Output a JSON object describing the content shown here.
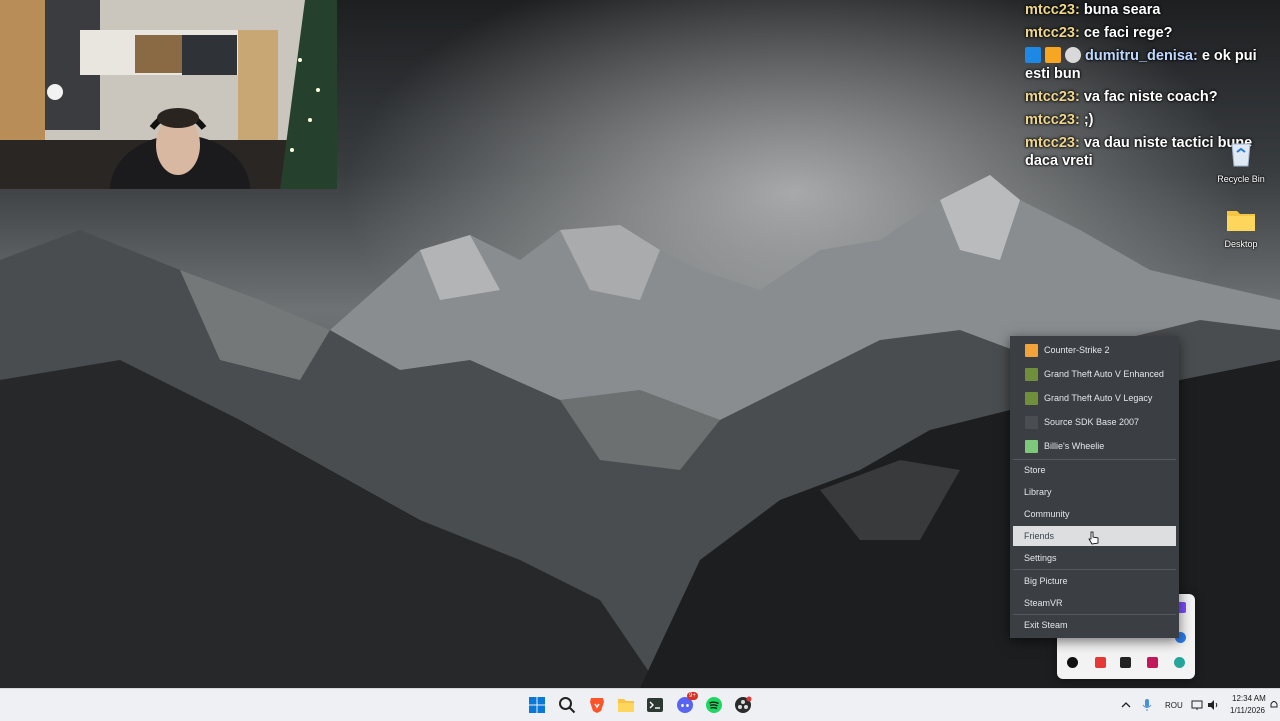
{
  "chat": [
    {
      "user": "mtcc23:",
      "text": "buna seara",
      "color": "gold"
    },
    {
      "user": "mtcc23:",
      "text": "ce faci rege?",
      "color": "gold"
    },
    {
      "user": "dumitru_denisa:",
      "text": "e ok pui esti bun",
      "color": "blue",
      "badges": [
        "sword-badge-icon",
        "crown-badge-icon",
        "snowman-badge-icon"
      ]
    },
    {
      "user": "mtcc23:",
      "text": "va fac niste coach?",
      "color": "gold"
    },
    {
      "user": "mtcc23:",
      "text": ";)",
      "color": "gold"
    },
    {
      "user": "mtcc23:",
      "text": "va dau niste tactici bune daca vreti",
      "color": "gold"
    }
  ],
  "desktop_icons": {
    "recycle_bin": "Recycle Bin",
    "desktop": "Desktop"
  },
  "steam_menu": {
    "games": [
      {
        "name": "Counter-Strike 2",
        "icon": "cs2-icon",
        "color": "#f2a33a"
      },
      {
        "name": "Grand Theft Auto V Enhanced",
        "icon": "gta-v-icon",
        "color": "#6f8f3a"
      },
      {
        "name": "Grand Theft Auto V Legacy",
        "icon": "gta-v-icon",
        "color": "#6f8f3a"
      },
      {
        "name": "Source SDK Base 2007",
        "icon": "source-sdk-icon",
        "color": "#4a4d52"
      },
      {
        "name": "Billie's Wheelie",
        "icon": "billies-wheelie-icon",
        "color": "#7ec87a"
      }
    ],
    "items": [
      "Store",
      "Library",
      "Community",
      "Friends",
      "Settings",
      "Big Picture",
      "SteamVR",
      "Exit Steam"
    ],
    "hovered": "Friends"
  },
  "taskbar": {
    "icons": [
      "windows-start-icon",
      "search-icon",
      "brave-browser-icon",
      "file-explorer-icon",
      "terminal-icon",
      "discord-icon",
      "spotify-icon",
      "obs-icon"
    ],
    "discord_badge": "9+",
    "language": "ROU",
    "time": "12:34 AM",
    "date": "1/11/2026"
  },
  "colors": {
    "menu_bg": "#3b3e43",
    "menu_hover": "#dcdedf",
    "taskbar_bg": "#eef0f3",
    "chat_user_gold": "#f0d68a",
    "chat_user_blue": "#bfd8ff"
  }
}
